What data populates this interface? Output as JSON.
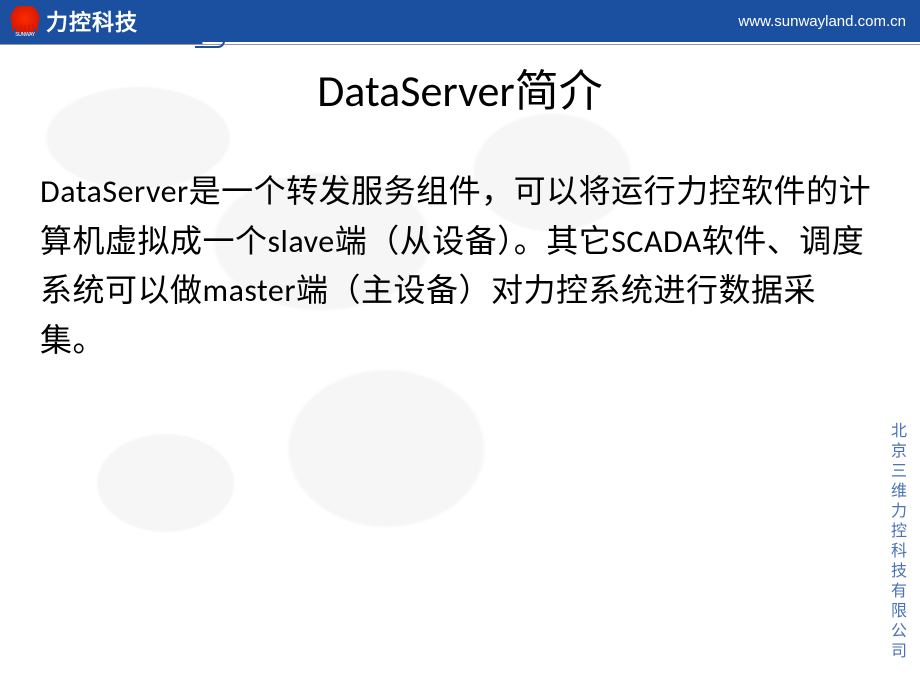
{
  "header": {
    "logo_brand": "力控科技",
    "logo_small": "SUNWAY",
    "website": "www.sunwayland.com.cn"
  },
  "slide": {
    "title": "DataServer简介",
    "body": "DataServer是一个转发服务组件，可以将运行力控软件的计算机虚拟成一个slave端（从设备）。其它SCADA软件、调度系统可以做master端（主设备）对力控系统进行数据采集。"
  },
  "footer": {
    "company_vertical": "北京三维力控科技有限公司"
  }
}
